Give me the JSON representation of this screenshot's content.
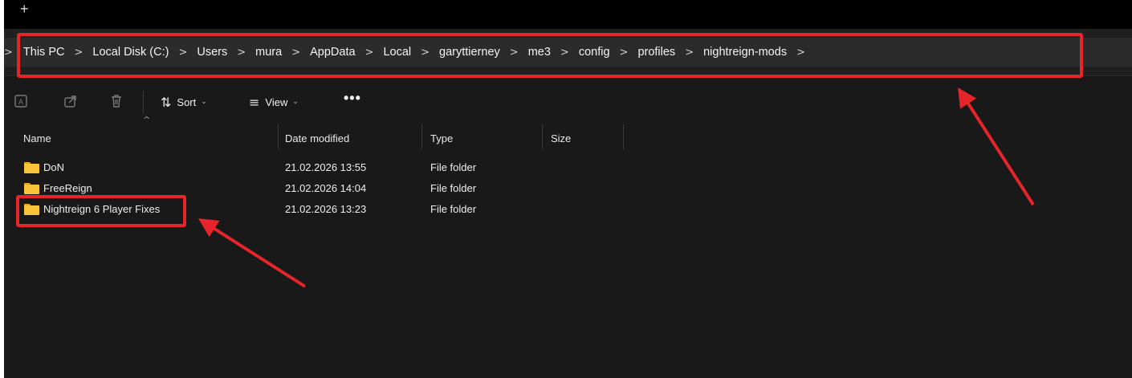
{
  "tabbar": {
    "new_tab_icon": "+"
  },
  "addressbar": {
    "separator": ">",
    "crumbs": [
      "This PC",
      "Local Disk (C:)",
      "Users",
      "mura",
      "AppData",
      "Local",
      "garyttierney",
      "me3",
      "config",
      "profiles",
      "nightreign-mods"
    ]
  },
  "toolbar": {
    "sort_label": "Sort",
    "view_label": "View",
    "more_label": "•••",
    "icons": [
      "rename-icon",
      "share-icon",
      "delete-icon",
      "sort-icon",
      "view-icon",
      "chevron-down-icon"
    ]
  },
  "columns": {
    "name": "Name",
    "date": "Date modified",
    "type": "Type",
    "size": "Size"
  },
  "files": [
    {
      "name": "DoN",
      "date": "21.02.2026 13:55",
      "type": "File folder",
      "size": ""
    },
    {
      "name": "FreeReign",
      "date": "21.02.2026 14:04",
      "type": "File folder",
      "size": ""
    },
    {
      "name": "Nightreign 6 Player Fixes",
      "date": "21.02.2026 13:23",
      "type": "File folder",
      "size": ""
    }
  ],
  "annotation_color": "#e5252a"
}
